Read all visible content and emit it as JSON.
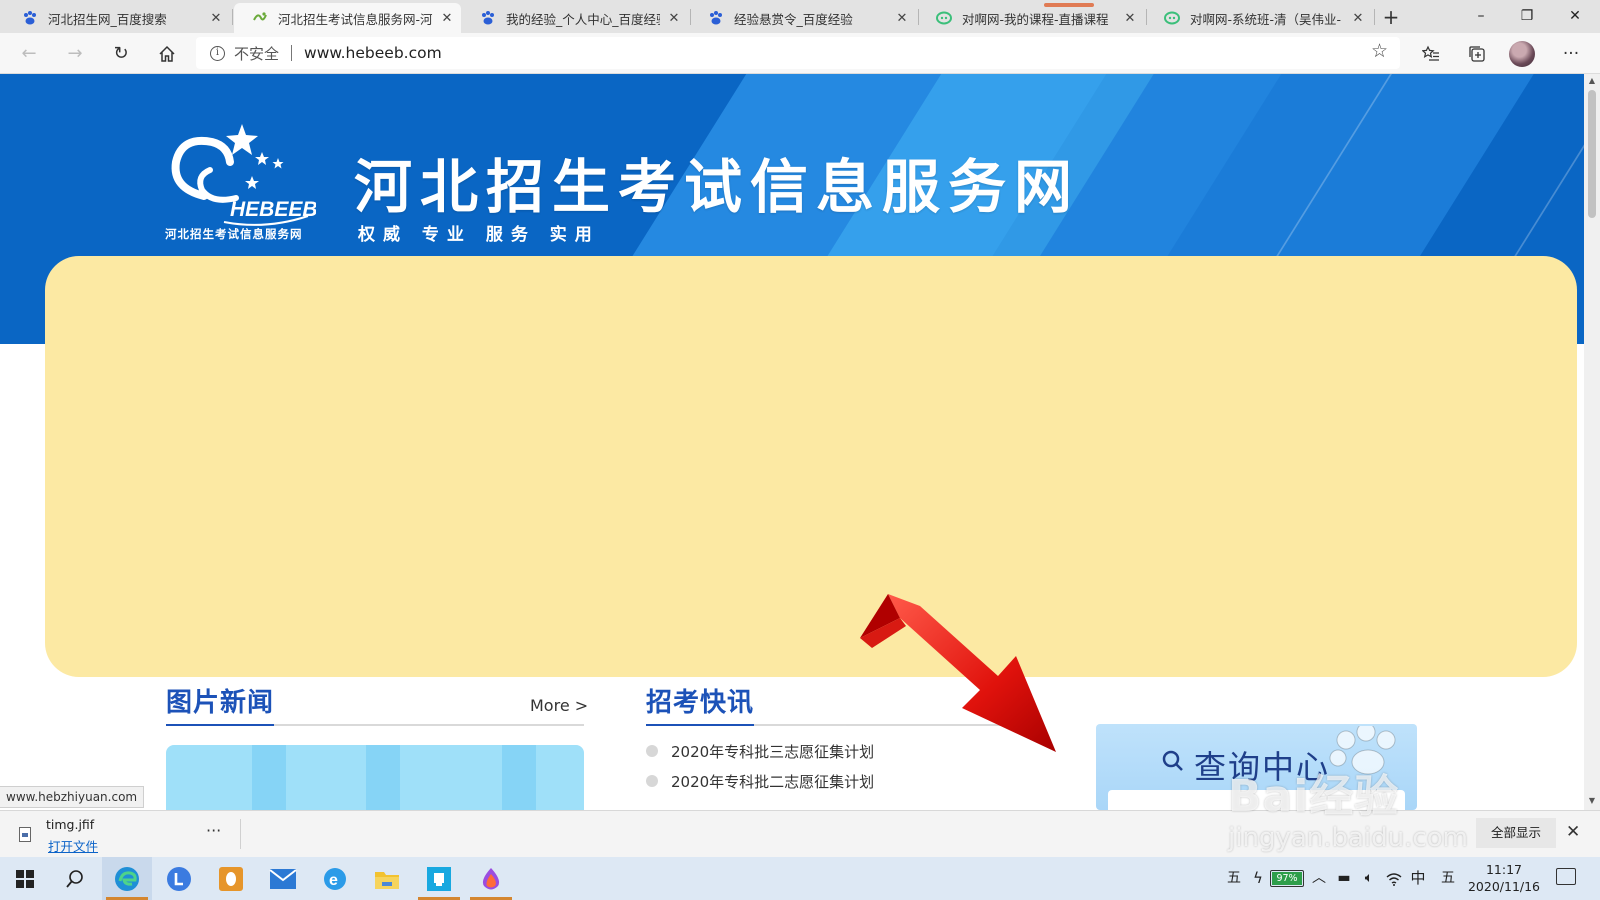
{
  "browser": {
    "tabs": [
      {
        "title": "河北招生网_百度搜索",
        "favicon": "baidu-paw-icon",
        "active": false
      },
      {
        "title": "河北招生考试信息服务网-河:",
        "favicon": "hebeeb-site-icon",
        "active": true
      },
      {
        "title": "我的经验_个人中心_百度经验",
        "favicon": "baidu-paw-icon",
        "active": false
      },
      {
        "title": "经验悬赏令_百度经验",
        "favicon": "baidu-paw-icon",
        "active": false
      },
      {
        "title": "对啊网-我的课程-直播课程",
        "favicon": "duia-icon",
        "active": false
      },
      {
        "title": "对啊网-系统班-清（吴伟业-",
        "favicon": "duia-icon",
        "active": false
      }
    ],
    "new_tab": "+",
    "window_controls": {
      "minimize": "–",
      "restore": "❐",
      "close": "✕"
    },
    "address": {
      "security_label": "不安全",
      "url": "www.hebeeb.com"
    },
    "icons": {
      "back": "back-arrow-icon",
      "forward": "forward-arrow-icon",
      "refresh": "refresh-icon",
      "home": "home-icon",
      "favorite": "star-icon",
      "favorites_list": "favorites-icon",
      "collections": "collections-icon",
      "more": "more-icon"
    },
    "status_url": "www.hebzhiyuan.com"
  },
  "page": {
    "logo_caption": "河北招生考试信息服务网",
    "logo_text": "HEBEEB",
    "site_title": "河北招生考试信息服务网",
    "slogan": "权威 专业 服务 实用",
    "photo_news": {
      "title": "图片新闻",
      "more": "More >"
    },
    "exam_news": {
      "title": "招考快讯",
      "items": [
        "2020年专科批三志愿征集计划",
        "2020年专科批二志愿征集计划"
      ]
    },
    "query_center": {
      "title": "查询中心"
    }
  },
  "download_bar": {
    "file_name": "timg.jfif",
    "open_label": "打开文件",
    "more_label": "···",
    "show_all_label": "全部显示",
    "close_label": "✕"
  },
  "taskbar": {
    "apps": [
      "windows-start-icon",
      "search-icon",
      "edge-icon",
      "app-l-icon",
      "qq-icon",
      "mail-icon",
      "ie-icon",
      "file-explorer-icon",
      "pinned-app-icon",
      "paint-icon"
    ],
    "tray": {
      "ime_left": "五",
      "battery_percent": "97%",
      "language": "中",
      "ime_right": "五",
      "time": "11:17",
      "date": "2020/11/16"
    }
  },
  "watermark": {
    "brand": "Bai经验",
    "url": "jingyan.baidu.com"
  },
  "colors": {
    "banner_blue": "#0a66c4",
    "ad_yellow": "#fce9a3",
    "section_title": "#1c52b8",
    "link_blue": "#0b63c8"
  }
}
